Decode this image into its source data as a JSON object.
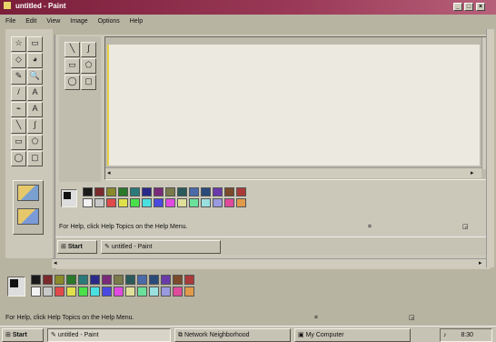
{
  "window": {
    "title": "untitled - Paint"
  },
  "menu": [
    "File",
    "Edit",
    "View",
    "Image",
    "Options",
    "Help"
  ],
  "tools": [
    {
      "name": "free-select-icon",
      "glyph": "☆"
    },
    {
      "name": "select-icon",
      "glyph": "▭"
    },
    {
      "name": "eraser-icon",
      "glyph": "◇"
    },
    {
      "name": "fill-icon",
      "glyph": "◕"
    },
    {
      "name": "color-picker-icon",
      "glyph": "✎"
    },
    {
      "name": "magnifier-icon",
      "glyph": "🔍"
    },
    {
      "name": "pencil-icon",
      "glyph": "/"
    },
    {
      "name": "brush-icon",
      "glyph": "A"
    },
    {
      "name": "airbrush-icon",
      "glyph": "⌁"
    },
    {
      "name": "text-icon",
      "glyph": "A"
    },
    {
      "name": "line-icon",
      "glyph": "╲"
    },
    {
      "name": "curve-icon",
      "glyph": "∫"
    },
    {
      "name": "rectangle-icon",
      "glyph": "▭"
    },
    {
      "name": "polygon-icon",
      "glyph": "⬠"
    },
    {
      "name": "ellipse-icon",
      "glyph": "◯"
    },
    {
      "name": "rounded-rect-icon",
      "glyph": "▢"
    }
  ],
  "inner_window": {
    "tools": [
      {
        "name": "line-icon",
        "glyph": "╲"
      },
      {
        "name": "curve-icon",
        "glyph": "∫"
      },
      {
        "name": "rectangle-icon",
        "glyph": "▭"
      },
      {
        "name": "polygon-icon",
        "glyph": "⬠"
      },
      {
        "name": "ellipse-icon",
        "glyph": "◯"
      },
      {
        "name": "rounded-rect-icon",
        "glyph": "▢"
      }
    ],
    "status_text": "For Help, click Help Topics on the Help Menu.",
    "task_start": "Start",
    "task_app": "untitled - Paint"
  },
  "palette": {
    "top": [
      "#1a1a1a",
      "#7a2a2a",
      "#8a8a2a",
      "#2a7a2a",
      "#2a7a7a",
      "#2a2a8a",
      "#7a2a7a",
      "#7a7a4a",
      "#2a5a5a",
      "#4a6aaa",
      "#2a4a7a",
      "#6a3aaa",
      "#7a4a2a",
      "#aa3a3a"
    ],
    "bottom": [
      "#f2f2f2",
      "#c8c8c8",
      "#e04a4a",
      "#e0e04a",
      "#4ae04a",
      "#4ae0e0",
      "#4a4ae0",
      "#e04ae0",
      "#e0e09a",
      "#6ae09a",
      "#9ae0e0",
      "#9a9ae0",
      "#e04a9a",
      "#e09a4a"
    ],
    "fg": "#111111",
    "bg": "#f2f2f2"
  },
  "status_bar": {
    "text": "For Help, click Help Topics on the Help Menu."
  },
  "taskbar": {
    "start": "Start",
    "items": [
      "untitled - Paint",
      "Network Neighborhood",
      "My Computer"
    ],
    "time": "8:30"
  }
}
